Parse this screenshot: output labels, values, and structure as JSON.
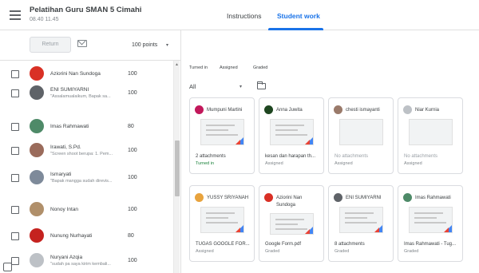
{
  "header": {
    "class_title": "Pelatihan Guru SMAN 5 Cimahi",
    "class_subtitle": "08.40 11.45",
    "tabs": [
      {
        "label": "Instructions"
      },
      {
        "label": "Student work"
      }
    ],
    "accent_color": "#1a73e8"
  },
  "toolbar": {
    "return_label": "Return",
    "mail_icon": "mail-icon",
    "points_label": "100 points",
    "points_caret": "▾"
  },
  "students": [
    {
      "name": "Aziorini Nan Sundoga",
      "comment": "",
      "grade": "100",
      "avatar_color": "#d93025"
    },
    {
      "name": "ENI SUMIYARNI",
      "comment": "\"Assalamualaikum, Bapak sa...",
      "grade": "100",
      "avatar_color": "#5f6368"
    },
    {
      "name": "Imas Rahmawati",
      "comment": "",
      "grade": "80",
      "avatar_color": "#4e8a68"
    },
    {
      "name": "Irawati, S.Pd.",
      "comment": "\"Screen shoot berupa: 1. Pem...",
      "grade": "100",
      "avatar_color": "#9a6b5b"
    },
    {
      "name": "Ismaryati",
      "comment": "\"Bapak mangga sudah direvis...",
      "grade": "100",
      "avatar_color": "#7e8a9a"
    },
    {
      "name": "Nonoy Intan",
      "comment": "",
      "grade": "100",
      "avatar_color": "#b08f6a"
    },
    {
      "name": "Nunung Nurhayati",
      "comment": "",
      "grade": "80",
      "avatar_color": "#c5221f"
    },
    {
      "name": "Nuryani Azqia",
      "comment": "\"sudah pa saya kirim kembali...",
      "grade": "100",
      "avatar_color": "#bdc1c6"
    }
  ],
  "stats": [
    {
      "label": "Turned in"
    },
    {
      "label": "Assigned"
    },
    {
      "label": "Graded"
    }
  ],
  "filter": {
    "value": "All",
    "caret": "▾"
  },
  "cards": [
    {
      "name": "Mumpuni Martini",
      "name2": "",
      "line1": "2 attachments",
      "line2": "Turned in",
      "status_color": "#188038",
      "has_thumb": true,
      "avatar_color": "#c2185b"
    },
    {
      "name": "Anna Juwita",
      "name2": "",
      "line1": "kesan dan harapan th...",
      "line2": "Assigned",
      "has_thumb": true,
      "avatar_color": "#1e4620"
    },
    {
      "name": "chesti ismayanti",
      "name2": "",
      "line1": "No attachments",
      "line2": "Assigned",
      "has_thumb": false,
      "avatar_color": "#9a7a6a"
    },
    {
      "name": "Niar Kurnia",
      "name2": "",
      "line1": "No attachments",
      "line2": "Assigned",
      "has_thumb": false,
      "avatar_color": "#bdc1c6"
    },
    {
      "name": "YUSSY SRIYANAH",
      "name2": "",
      "line1": "TUGAS GOOGLE FOR...",
      "line2": "Assigned",
      "has_thumb": true,
      "avatar_color": "#e8a33d"
    },
    {
      "name": "Aziorini Nan",
      "name2": "Sundoga",
      "line1": "Google Form.pdf",
      "line2": "Graded",
      "has_thumb": true,
      "avatar_color": "#d93025"
    },
    {
      "name": "ENI SUMIYARNI",
      "name2": "",
      "line1": "8 attachments",
      "line2": "Graded",
      "has_thumb": true,
      "avatar_color": "#5f6368"
    },
    {
      "name": "Imas Rahmawati",
      "name2": "",
      "line1": "Imas Rahmawati - Tug...",
      "line2": "Graded",
      "has_thumb": true,
      "avatar_color": "#4e8a68"
    }
  ]
}
